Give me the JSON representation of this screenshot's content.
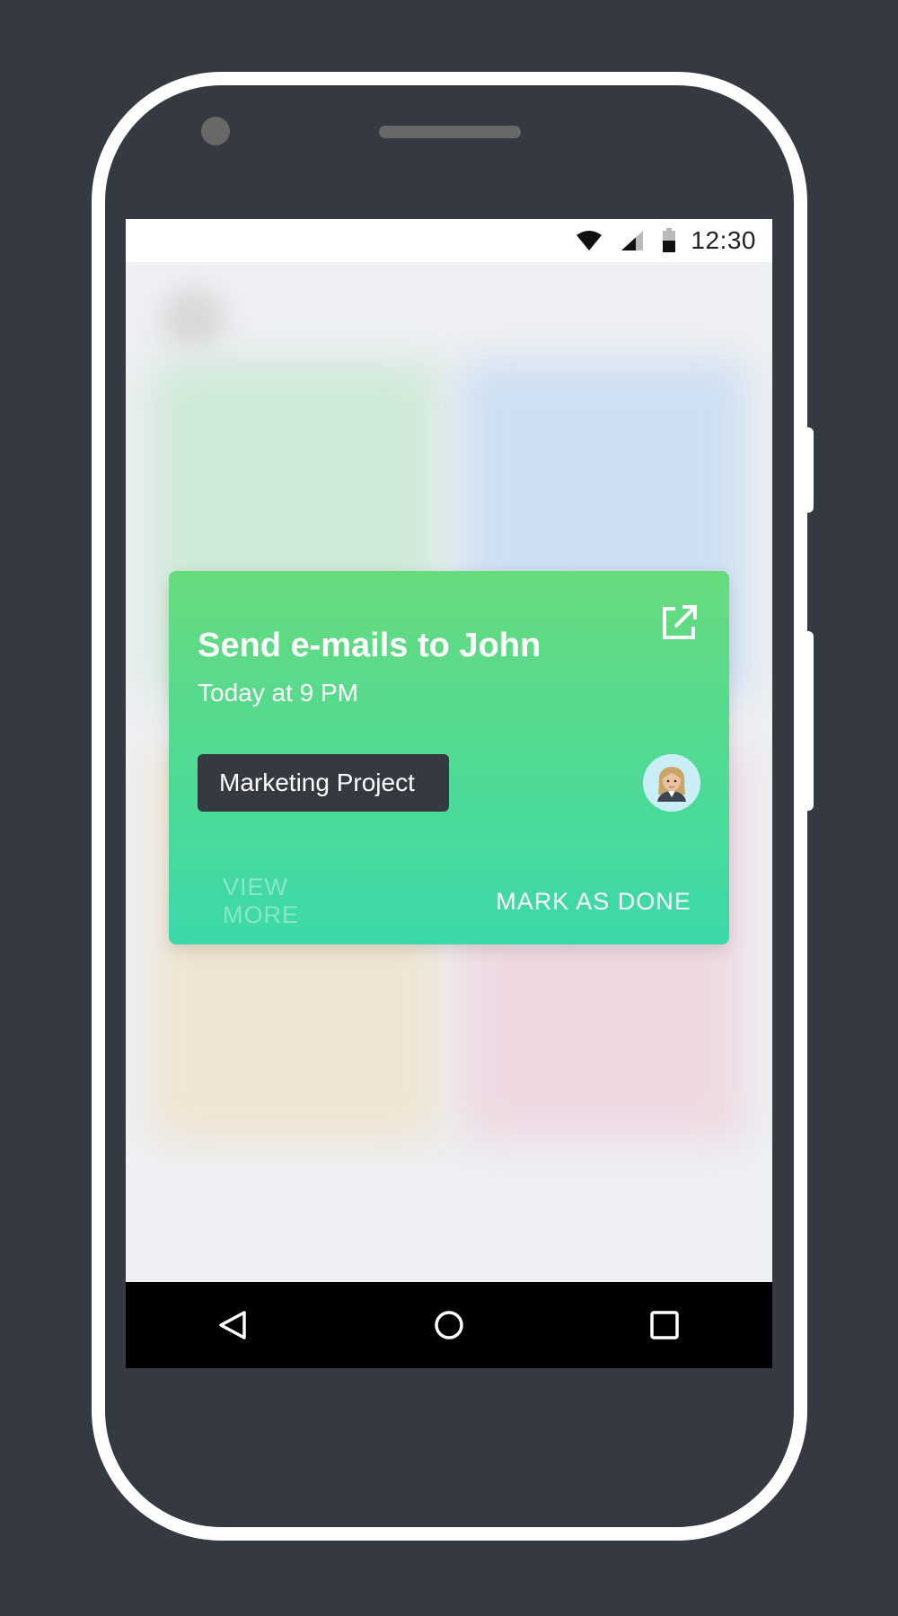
{
  "status_bar": {
    "time": "12:30",
    "icons": [
      "wifi-icon",
      "signal-icon",
      "battery-icon"
    ]
  },
  "card": {
    "title": "Send e-mails to John",
    "subtitle": "Today at 9 PM",
    "tag": "Marketing Project",
    "assignee_icon": "woman-office-worker-avatar",
    "open_icon": "open-external-icon",
    "actions": {
      "view_more": "VIEW MORE",
      "mark_as_done": "MARK AS DONE"
    }
  },
  "nav_bar": {
    "icons": [
      "back-icon",
      "home-icon",
      "recents-icon"
    ]
  },
  "colors": {
    "card_gradient_top": "#67db7d",
    "card_gradient_bottom": "#3bd9a9",
    "tag_background": "#353a42",
    "frame_background": "#353a42",
    "frame_border": "#ffffff"
  }
}
